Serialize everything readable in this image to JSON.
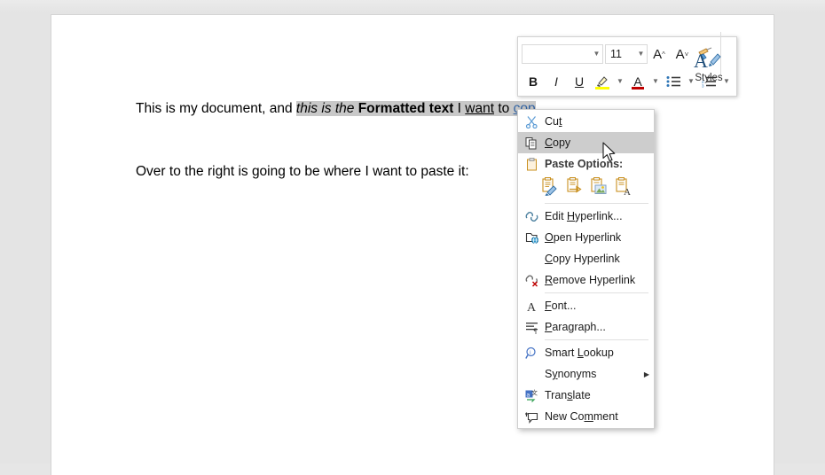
{
  "document": {
    "paragraph1": {
      "plain_before": "This is my document, and ",
      "italic_part": "this is the ",
      "bold_part": "Formatted text",
      "after_bold": " I ",
      "underlined_part": "want",
      "between": " to ",
      "hyperlink_part": "cop"
    },
    "paragraph2": "Over to the right is going to be where I want to paste it:"
  },
  "mini_toolbar": {
    "font_name": "",
    "font_name_placeholder": "",
    "font_size": "11",
    "grow_font_label": "A",
    "shrink_font_label": "A",
    "format_painter": "format-painter",
    "bold_label": "B",
    "italic_label": "I",
    "underline_label": "U",
    "highlight_label": "highlight",
    "font_color_label": "A",
    "bullets_label": "bullets",
    "numbering_label": "numbering",
    "styles_label": "Styles",
    "highlight_color": "#ffff00",
    "font_color": "#c00000"
  },
  "context_menu": {
    "items": [
      {
        "id": "cut",
        "label": "Cut",
        "accel": "t",
        "icon": "scissors-icon",
        "type": "item"
      },
      {
        "id": "copy",
        "label": "Copy",
        "accel": "C",
        "icon": "copy-icon",
        "type": "item",
        "hovered": true
      },
      {
        "id": "paste-options",
        "label": "Paste Options:",
        "icon": "clipboard-icon",
        "type": "header"
      },
      {
        "id": "paste-icons",
        "type": "icons",
        "options": [
          {
            "id": "keep-source-formatting",
            "icon": "paste-keep-source-formatting-icon"
          },
          {
            "id": "merge-formatting",
            "icon": "paste-merge-formatting-icon"
          },
          {
            "id": "picture",
            "icon": "paste-picture-icon"
          },
          {
            "id": "keep-text-only",
            "icon": "paste-keep-text-only-icon"
          }
        ]
      },
      {
        "id": "separator-1",
        "type": "separator"
      },
      {
        "id": "edit-hyperlink",
        "label": "Edit Hyperlink...",
        "accel": "H",
        "icon": "edit-hyperlink-icon",
        "type": "item"
      },
      {
        "id": "open-hyperlink",
        "label": "Open Hyperlink",
        "accel": "O",
        "icon": "open-hyperlink-icon",
        "type": "item"
      },
      {
        "id": "copy-hyperlink",
        "label": "Copy Hyperlink",
        "accel": "C",
        "icon": "none",
        "type": "item"
      },
      {
        "id": "remove-hyperlink",
        "label": "Remove Hyperlink",
        "accel": "R",
        "icon": "remove-hyperlink-icon",
        "type": "item"
      },
      {
        "id": "separator-2",
        "type": "separator"
      },
      {
        "id": "font",
        "label": "Font...",
        "accel": "F",
        "icon": "font-icon",
        "type": "item"
      },
      {
        "id": "paragraph",
        "label": "Paragraph...",
        "accel": "P",
        "icon": "paragraph-icon",
        "type": "item"
      },
      {
        "id": "separator-3",
        "type": "separator"
      },
      {
        "id": "smart-lookup",
        "label": "Smart Lookup",
        "accel": "L",
        "icon": "smart-lookup-icon",
        "type": "item"
      },
      {
        "id": "synonyms",
        "label": "Synonyms",
        "accel": "y",
        "icon": "none",
        "type": "submenu",
        "arrow": "▶"
      },
      {
        "id": "translate",
        "label": "Translate",
        "accel": "s",
        "icon": "translate-icon",
        "type": "item"
      },
      {
        "id": "new-comment",
        "label": "New Comment",
        "accel": "m",
        "icon": "new-comment-icon",
        "type": "item"
      }
    ],
    "labels": {
      "cut": "Cut",
      "copy": "Copy",
      "paste_options": "Paste Options:",
      "edit_hyperlink": "Edit Hyperlink...",
      "open_hyperlink": "Open Hyperlink",
      "copy_hyperlink": "Copy Hyperlink",
      "remove_hyperlink": "Remove Hyperlink",
      "font": "Font...",
      "paragraph": "Paragraph...",
      "smart_lookup": "Smart Lookup",
      "synonyms": "Synonyms",
      "translate": "Translate",
      "new_comment": "New Comment",
      "submenu_arrow": "▶"
    }
  },
  "colors": {
    "page_background": "#ffffff",
    "workspace_background": "#e4e4e4",
    "selection_highlight": "#c8c8c8",
    "menu_hover": "#cdcdcd",
    "hyperlink": "#3465a4"
  }
}
